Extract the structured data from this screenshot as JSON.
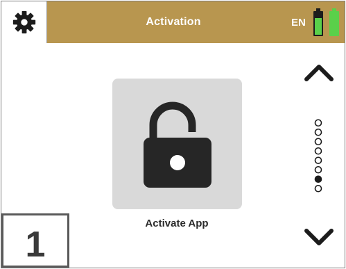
{
  "header": {
    "title": "Activation",
    "language": "EN",
    "background_color": "#b8964f",
    "settings_icon": "gear-icon",
    "status_icon": "battery-icon"
  },
  "main": {
    "app_tile": {
      "icon": "unlocked-padlock-icon",
      "label": "Activate App"
    }
  },
  "navigation": {
    "up_icon": "chevron-up-icon",
    "down_icon": "chevron-down-icon",
    "page_indicator": {
      "total": 8,
      "active_index": 6
    }
  },
  "page_number": "1"
}
